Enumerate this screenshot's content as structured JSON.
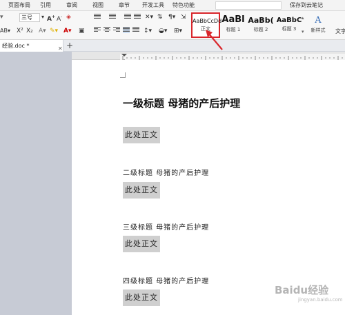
{
  "menubar": {
    "items": [
      "页面布局",
      "引用",
      "审阅",
      "视图",
      "章节",
      "开发工具",
      "特色功能"
    ],
    "cloud_save": "保存到云笔记"
  },
  "ribbon": {
    "font_size": "三号",
    "style_gallery": [
      {
        "preview": "AaBbCcDd",
        "name": "正文"
      },
      {
        "preview": "AaBl",
        "name": "标题 1"
      },
      {
        "preview": "AaBb(",
        "name": "标题 2"
      },
      {
        "preview": "AaBbC",
        "name": "标题 3"
      }
    ],
    "new_style_label": "新样式",
    "text_tool_label": "文字"
  },
  "tabs": {
    "doc_name": "经验.doc *",
    "new_tab": "+"
  },
  "document": {
    "h1": "一级标题  母猪的产后护理",
    "body": "此处正文",
    "h2": "二级标题  母猪的产后护理",
    "h3": "三级标题  母猪的产后护理",
    "h4": "四级标题  母猪的产后护理"
  },
  "watermark": {
    "main": "Baidu经验",
    "sub": "jingyan.baidu.com"
  },
  "colors": {
    "highlight_border": "#d9262c",
    "body_highlight": "#cfcfcf"
  }
}
